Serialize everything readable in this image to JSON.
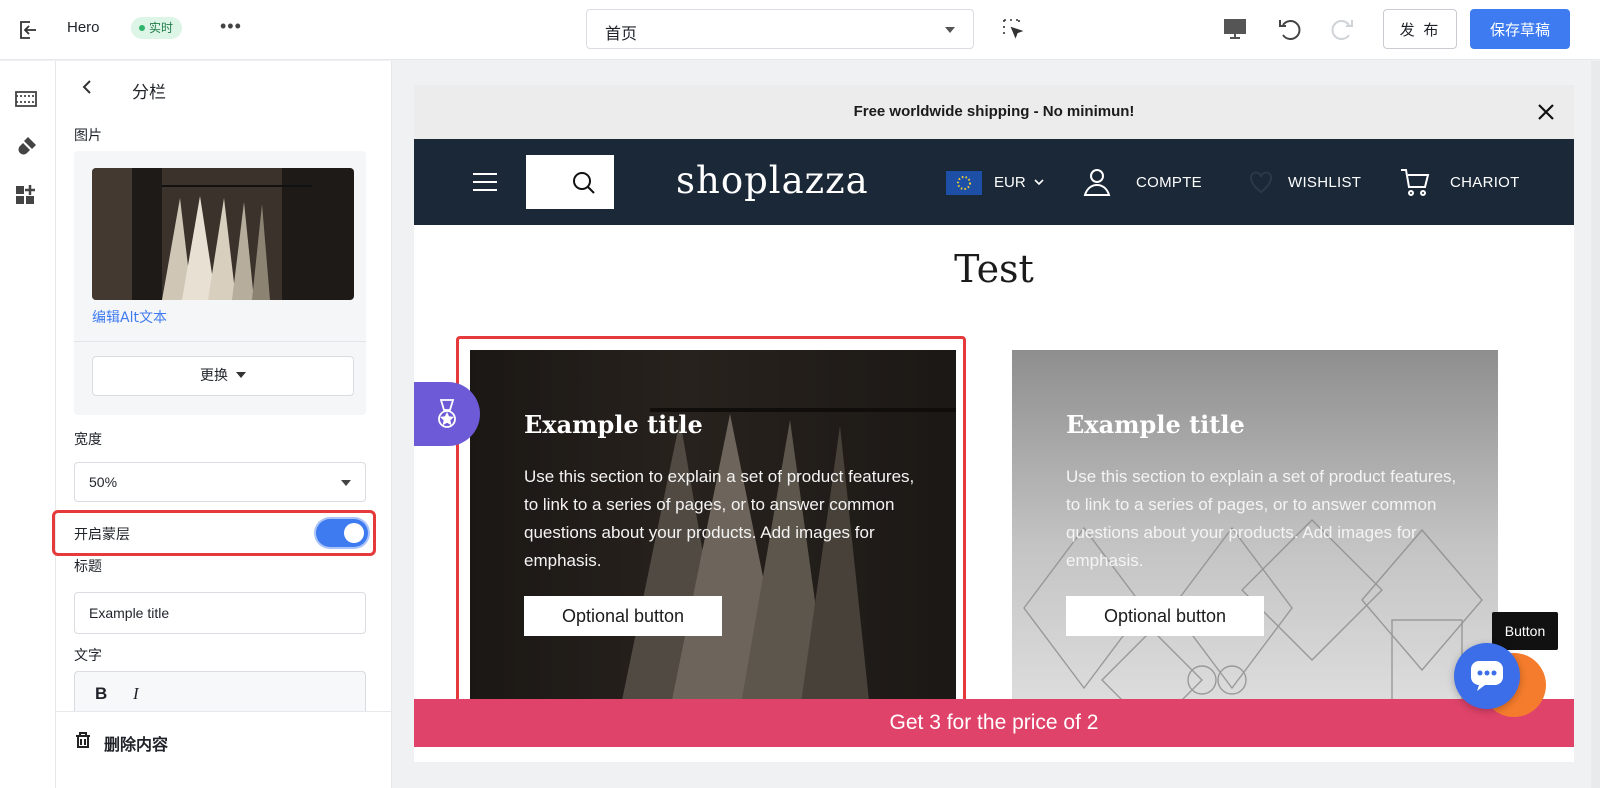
{
  "topbar": {
    "app_name": "Hero",
    "live_badge": "实时",
    "more": "•••",
    "page_select": "首页",
    "publish": "发 布",
    "save_draft": "保存草稿"
  },
  "panel": {
    "title": "分栏",
    "image_label": "图片",
    "edit_alt": "编辑Alt文本",
    "replace": "更换",
    "width_label": "宽度",
    "width_value": "50%",
    "overlay_label": "开启蒙层",
    "overlay_on": true,
    "heading_label": "标题",
    "heading_value": "Example title",
    "text_label": "文字",
    "bold": "B",
    "italic": "I",
    "delete": "删除内容"
  },
  "preview": {
    "announcement": "Free worldwide shipping - No minimun!",
    "logo": "shoplazza",
    "currency": "EUR",
    "account": "COMPTE",
    "wishlist": "WISHLIST",
    "cart": "CHARIOT",
    "section_title": "Test",
    "columns": [
      {
        "title": "Example title",
        "text": "Use this section to explain a set of product features, to link to a series of pages, or to answer common questions about your products. Add images for emphasis.",
        "button": "Optional button"
      },
      {
        "title": "Example title",
        "text": "Use this section to explain a set of product features, to link to a series of pages, or to answer common questions about your products. Add images for emphasis.",
        "button": "Optional button"
      }
    ],
    "promo": "Get 3 for the price of 2",
    "tooltip": "Button"
  },
  "colors": {
    "accent": "#3e7bf0",
    "header_bg": "#1b2838",
    "promo_bg": "#e0436a",
    "selection": "#e5393b",
    "live_badge_bg": "#dcf5e6"
  },
  "icons": [
    "exit-icon",
    "select-tool-icon",
    "desktop-icon",
    "undo-icon",
    "redo-icon",
    "sections-icon",
    "theme-icon",
    "apps-icon",
    "back-icon",
    "trash-icon",
    "menu-icon",
    "search-icon",
    "flag-icon",
    "user-icon",
    "heart-icon",
    "cart-icon",
    "close-icon",
    "medal-icon",
    "chat-icon"
  ]
}
